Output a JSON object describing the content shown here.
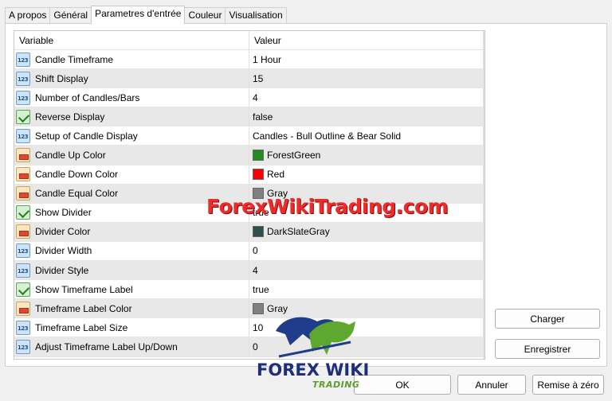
{
  "tabs": [
    {
      "label": "A propos",
      "active": false
    },
    {
      "label": "Général",
      "active": false
    },
    {
      "label": "Parametres d'entrée",
      "active": true
    },
    {
      "label": "Couleur",
      "active": false
    },
    {
      "label": "Visualisation",
      "active": false
    }
  ],
  "grid": {
    "headers": {
      "variable": "Variable",
      "value": "Valeur"
    },
    "rows": [
      {
        "variable": "Candle Timeframe",
        "value": "1 Hour",
        "type": "number"
      },
      {
        "variable": "Shift Display",
        "value": "15",
        "type": "number"
      },
      {
        "variable": "Number of Candles/Bars",
        "value": "4",
        "type": "number"
      },
      {
        "variable": "Reverse Display",
        "value": "false",
        "type": "bool"
      },
      {
        "variable": "Setup of Candle Display",
        "value": "Candles - Bull Outline & Bear Solid",
        "type": "number"
      },
      {
        "variable": "Candle Up Color",
        "value": "ForestGreen",
        "type": "color",
        "swatch": "#228b22"
      },
      {
        "variable": "Candle Down Color",
        "value": "Red",
        "type": "color",
        "swatch": "#ff0000"
      },
      {
        "variable": "Candle Equal Color",
        "value": "Gray",
        "type": "color",
        "swatch": "#808080"
      },
      {
        "variable": "Show Divider",
        "value": "true",
        "type": "bool"
      },
      {
        "variable": "Divider Color",
        "value": "DarkSlateGray",
        "type": "color",
        "swatch": "#2f4f4f"
      },
      {
        "variable": "Divider Width",
        "value": "0",
        "type": "number"
      },
      {
        "variable": "Divider Style",
        "value": "4",
        "type": "number"
      },
      {
        "variable": "Show Timeframe Label",
        "value": "true",
        "type": "bool"
      },
      {
        "variable": "Timeframe Label Color",
        "value": "Gray",
        "type": "color",
        "swatch": "#808080"
      },
      {
        "variable": "Timeframe Label Size",
        "value": "10",
        "type": "number"
      },
      {
        "variable": "Adjust Timeframe Label Up/Down",
        "value": "0",
        "type": "number"
      }
    ]
  },
  "buttons": {
    "load": "Charger",
    "save": "Enregistrer",
    "ok": "OK",
    "cancel": "Annuler",
    "reset": "Remise à zéro"
  },
  "watermark": "ForexWikiTrading.com",
  "logo": {
    "main": "FOREX WIKI",
    "sub": "TRADING"
  }
}
